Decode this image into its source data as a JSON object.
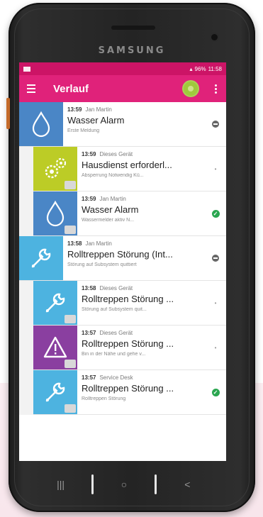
{
  "device": {
    "brand": "SAMSUNG"
  },
  "status_bar": {
    "time": "11:58",
    "battery": "96%"
  },
  "app_bar": {
    "title": "Verlauf"
  },
  "colors": {
    "primary": "#e0227a",
    "status_bar": "#cc1466",
    "blue": "#4a86c6",
    "cyan": "#4db3e0",
    "lime": "#bccc26",
    "purple": "#8a3fa0",
    "green_check": "#2aa650"
  },
  "history": [
    {
      "time": "13:59",
      "author": "Jan Martin",
      "title": "Wasser Alarm",
      "subtitle": "Erste Meldung",
      "icon": "water-drop-icon",
      "color": "#4a86c6",
      "child": false,
      "state": "open"
    },
    {
      "time": "13:59",
      "author": "Dieses Gerät",
      "title": "Hausdienst erforderl...",
      "subtitle": "Absperrung Notwendig Kü...",
      "icon": "gears-icon",
      "color": "#bccc26",
      "child": true,
      "state": "pending"
    },
    {
      "time": "13:59",
      "author": "Jan Martin",
      "title": "Wasser Alarm",
      "subtitle": "Wassermelder aktiv N...",
      "icon": "water-drop-icon",
      "color": "#4a86c6",
      "child": true,
      "state": "done"
    },
    {
      "time": "13:58",
      "author": "Jan Martin",
      "title": "Rolltreppen Störung (Int...",
      "subtitle": "Störung auf Subsystem quittiert",
      "icon": "wrench-icon",
      "color": "#4db3e0",
      "child": false,
      "state": "open"
    },
    {
      "time": "13:58",
      "author": "Dieses Gerät",
      "title": "Rolltreppen Störung ...",
      "subtitle": "Störung auf Subsystem quit...",
      "icon": "wrench-icon",
      "color": "#4db3e0",
      "child": true,
      "state": "pending"
    },
    {
      "time": "13:57",
      "author": "Dieses Gerät",
      "title": "Rolltreppen Störung ...",
      "subtitle": "Bin in der Nähe und gehe v...",
      "icon": "warning-icon",
      "color": "#8a3fa0",
      "child": true,
      "state": "pending"
    },
    {
      "time": "13:57",
      "author": "Service Desk",
      "title": "Rolltreppen Störung ...",
      "subtitle": "Rolltreppen Störung",
      "icon": "wrench-icon",
      "color": "#4db3e0",
      "child": true,
      "state": "done"
    }
  ],
  "nav_bar": {
    "recents": "|||",
    "home": "○",
    "back": "<"
  }
}
